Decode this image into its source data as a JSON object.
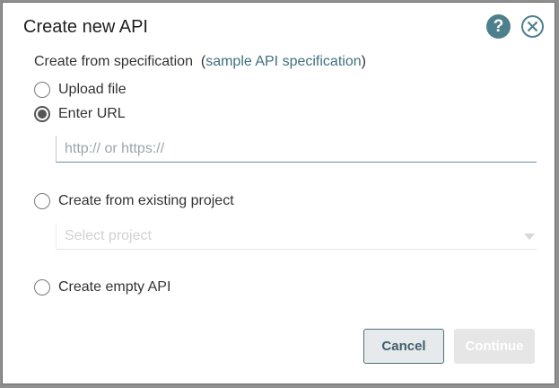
{
  "dialog": {
    "title": "Create new API",
    "subtitle_prefix": "Create from specification  (",
    "subtitle_link": "sample API specification",
    "subtitle_suffix": ")"
  },
  "options": {
    "upload_file": "Upload file",
    "enter_url": "Enter URL",
    "from_project": "Create from existing project",
    "empty_api": "Create empty API"
  },
  "url_input": {
    "placeholder": "http:// or https://",
    "value": ""
  },
  "project_select": {
    "placeholder": "Select project"
  },
  "buttons": {
    "cancel": "Cancel",
    "continue": "Continue"
  },
  "colors": {
    "accent": "#4e7f8c",
    "link": "#3f6f7f"
  },
  "icons": {
    "help": "help-icon",
    "close": "close-icon"
  }
}
